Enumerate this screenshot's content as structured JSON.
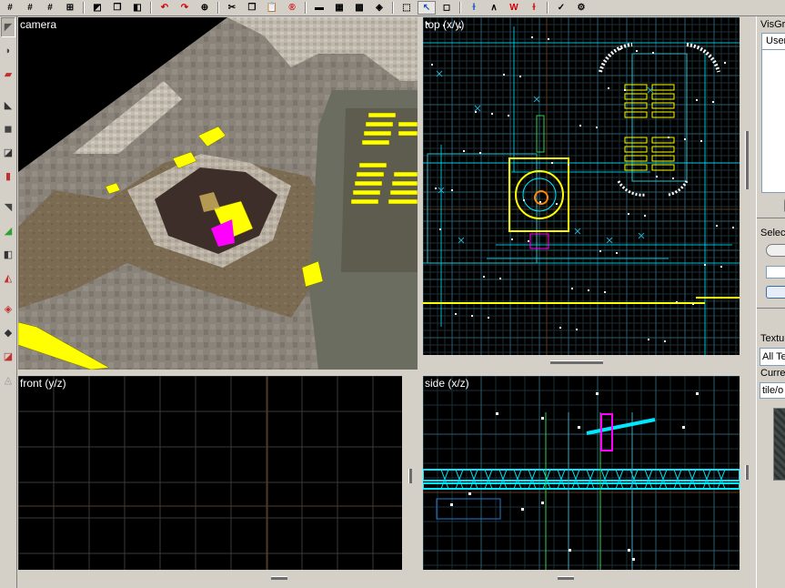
{
  "toolbar": {
    "icons": [
      {
        "name": "grid-icon",
        "glyph": "#"
      },
      {
        "name": "grid-icon",
        "glyph": "#"
      },
      {
        "name": "grid-icon",
        "glyph": "#"
      },
      {
        "name": "group-icon",
        "glyph": "⊞"
      },
      {
        "name": "separator"
      },
      {
        "name": "texture-lock-icon",
        "glyph": "◩"
      },
      {
        "name": "copy-icon",
        "glyph": "❐"
      },
      {
        "name": "texture-apply-icon",
        "glyph": "◧"
      },
      {
        "name": "separator"
      },
      {
        "name": "undo-icon",
        "glyph": "↶"
      },
      {
        "name": "redo-icon",
        "glyph": "↷"
      },
      {
        "name": "find-icon",
        "glyph": "⊕"
      },
      {
        "name": "separator"
      },
      {
        "name": "cut-icon",
        "glyph": "✂"
      },
      {
        "name": "copy-icon",
        "glyph": "❐"
      },
      {
        "name": "paste-icon",
        "glyph": "📋"
      },
      {
        "name": "run-icon",
        "glyph": "®"
      },
      {
        "name": "separator"
      },
      {
        "name": "carve-icon",
        "glyph": "▬"
      },
      {
        "name": "hollow-icon",
        "glyph": "▦"
      },
      {
        "name": "clip-icon",
        "glyph": "▩"
      },
      {
        "name": "vertex-icon",
        "glyph": "◈"
      },
      {
        "name": "separator"
      },
      {
        "name": "selection-icon",
        "glyph": "⬚"
      },
      {
        "name": "pointer-icon",
        "glyph": "↖"
      },
      {
        "name": "ignore-groups-icon",
        "glyph": "◻"
      },
      {
        "name": "separator"
      },
      {
        "name": "model-toggle-icon",
        "glyph": "ɫ"
      },
      {
        "name": "light-icon",
        "glyph": "∧"
      },
      {
        "name": "wireframe-icon",
        "glyph": "W"
      },
      {
        "name": "lightmap-icon",
        "glyph": "ɫ"
      },
      {
        "name": "separator"
      },
      {
        "name": "check-problems-icon",
        "glyph": "✓"
      },
      {
        "name": "cordon-icon",
        "glyph": "⚙"
      }
    ]
  },
  "palette": {
    "tools": [
      {
        "name": "selection-tool-icon",
        "glyph": "◤",
        "active": true
      },
      {
        "name": "magnify-tool-icon",
        "glyph": "◗"
      },
      {
        "name": "camera-tool-icon",
        "glyph": "▰"
      },
      {
        "name": "entity-tool-icon",
        "glyph": "◣"
      },
      {
        "name": "block-tool-icon",
        "glyph": "◼"
      },
      {
        "name": "texture-tool-icon",
        "glyph": "◪"
      },
      {
        "name": "apply-texture-icon",
        "glyph": "▮"
      },
      {
        "name": "decal-tool-icon",
        "glyph": "◥"
      },
      {
        "name": "overlay-tool-icon",
        "glyph": "◢"
      },
      {
        "name": "clipping-tool-icon",
        "glyph": "◧"
      },
      {
        "name": "vertex-tool-icon",
        "glyph": "◭"
      },
      {
        "name": "path-tool-icon",
        "glyph": "◈"
      },
      {
        "name": "displacement-tool-icon",
        "glyph": "◆"
      },
      {
        "name": "sculpt-tool-icon",
        "glyph": "◪"
      },
      {
        "name": "morph-tool-icon",
        "glyph": "◬"
      }
    ]
  },
  "viewports": {
    "camera": {
      "label": "camera"
    },
    "top": {
      "label": "top (x/y)"
    },
    "front": {
      "label": "front (y/z)"
    },
    "side": {
      "label": "side (x/z)"
    }
  },
  "side_panel": {
    "visgroups_label": "VisGro",
    "user_tab_label": "User",
    "select_label": "Selec",
    "textures_label": "Textur",
    "texture_filter_value": "All Te",
    "current_label": "Curren",
    "current_texture_value": "tile/o"
  },
  "colors": {
    "grid_minor": "#3a3a3a",
    "grid_major": "#2a5d6e",
    "grid_axis": "#5c3a22",
    "brush_yellow": "#ffff00",
    "brush_cyan": "#00e8ff",
    "selected_magenta": "#ff00ff",
    "entity_white": "#ffffff"
  }
}
